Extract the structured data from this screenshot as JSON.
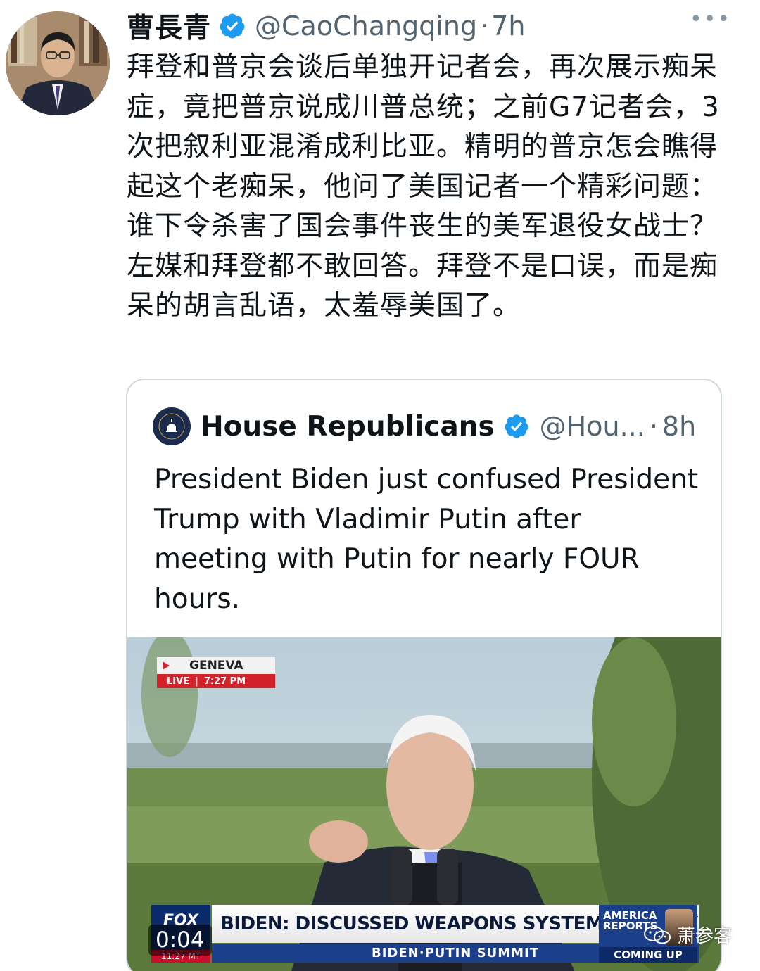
{
  "tweet": {
    "author_name": "曹長青",
    "handle": "@CaoChangqing",
    "separator": "·",
    "time": "7h",
    "more_label": "•••",
    "text": "拜登和普京会谈后单独开记者会，再次展示痴呆症，竟把普京说成川普总统；之前G7记者会，3次把叙利亚混淆成利比亚。精明的普京怎会瞧得起这个老痴呆，他问了美国记者一个精彩问题：谁下令杀害了国会事件丧生的美军退役女战士？左媒和拜登都不敢回答。拜登不是口误，而是痴呆的胡言乱语，太羞辱美国了。"
  },
  "quoted": {
    "author_name": "House Republicans",
    "handle": "@Hou...",
    "separator": "·",
    "time": "8h",
    "text": "President Biden just confused President Trump with Vladimir Putin after meeting with Putin for nearly FOUR hours.",
    "media": {
      "location": "GENEVA",
      "live": "LIVE",
      "broadcast_time": "7:27 PM",
      "network": "FOX",
      "corner_time": "11:27 MT",
      "headline": "BIDEN: DISCUSSED WEAPONS SYSTEMS AND CYBERSECURITY",
      "ticker": "BIDEN·PUTIN SUMMIT",
      "show": "AMERICA REPORTS",
      "coming_up": "COMING UP",
      "video_time": "0:04"
    }
  },
  "watermark": "萧参客",
  "colors": {
    "verified": "#1d9bf0",
    "secondary_text": "#536471",
    "border": "#cfd9de"
  }
}
